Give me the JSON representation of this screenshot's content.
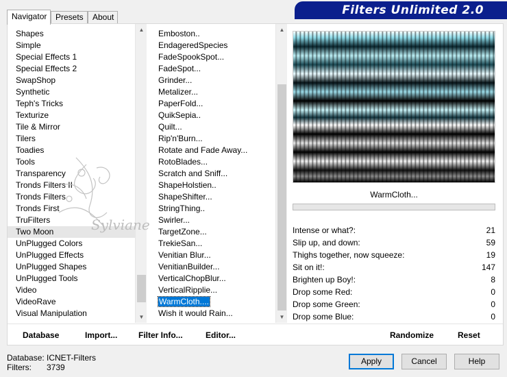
{
  "tabs": [
    {
      "label": "Navigator",
      "active": true
    },
    {
      "label": "Presets",
      "active": false
    },
    {
      "label": "About",
      "active": false
    }
  ],
  "banner": {
    "title": "Filters Unlimited 2.0"
  },
  "categories": {
    "items": [
      "Shapes",
      "Simple",
      "Special Effects 1",
      "Special Effects 2",
      "SwapShop",
      "Synthetic",
      "Teph's Tricks",
      "Texturize",
      "Tile & Mirror",
      "Tilers",
      "Toadies",
      "Tools",
      "Transparency",
      "Tronds Filters II",
      "Tronds Filters",
      "Tronds First",
      "TruFilters",
      "Two Moon",
      "UnPlugged Colors",
      "UnPlugged Effects",
      "UnPlugged Shapes",
      "UnPlugged Tools",
      "Video",
      "VideoRave",
      "Visual Manipulation"
    ],
    "selected": "Two Moon"
  },
  "filters": {
    "items": [
      "Emboston..",
      "EndageredSpecies",
      "FadeSpookSpot...",
      "FadeSpot...",
      "Grinder...",
      "Metalizer...",
      "PaperFold...",
      "QuikSepia..",
      "Quilt...",
      "Rip'n'Burn...",
      "Rotate and Fade Away...",
      "RotoBlades...",
      "Scratch and Sniff...",
      "ShapeHolstien..",
      "ShapeShifter...",
      "StringThing..",
      "Swirler...",
      "TargetZone...",
      "TrekieSan...",
      "Venitian Blur...",
      "VenitianBuilder...",
      "VerticalChopBlur...",
      "VerticalRipplie...",
      "WarmCloth....",
      "Wish it would Rain..."
    ],
    "selected": "WarmCloth...."
  },
  "watermark": {
    "text": "Sylviane"
  },
  "preview": {
    "filter_name": "WarmCloth..."
  },
  "params": [
    {
      "label": "Intense or what?:",
      "value": "21"
    },
    {
      "label": "Slip up, and down:",
      "value": "59"
    },
    {
      "label": "Thighs together, now squeeze:",
      "value": "19"
    },
    {
      "label": "Sit on it!:",
      "value": "147"
    },
    {
      "label": "Brighten up Boy!:",
      "value": "8"
    },
    {
      "label": "Drop some Red:",
      "value": "0"
    },
    {
      "label": "Drop some Green:",
      "value": "0"
    },
    {
      "label": "Drop some Blue:",
      "value": "0"
    }
  ],
  "panel_buttons": {
    "database": "Database",
    "import": "Import...",
    "filter_info": "Filter Info...",
    "editor": "Editor...",
    "randomize": "Randomize",
    "reset": "Reset"
  },
  "info": {
    "database_label": "Database:",
    "database_value": "ICNET-Filters",
    "filters_label": "Filters:",
    "filters_value": "3739"
  },
  "dialog_buttons": {
    "apply": "Apply",
    "cancel": "Cancel",
    "help": "Help"
  },
  "colors": {
    "banner": "#0b1f8d",
    "selection": "#0078d7"
  }
}
